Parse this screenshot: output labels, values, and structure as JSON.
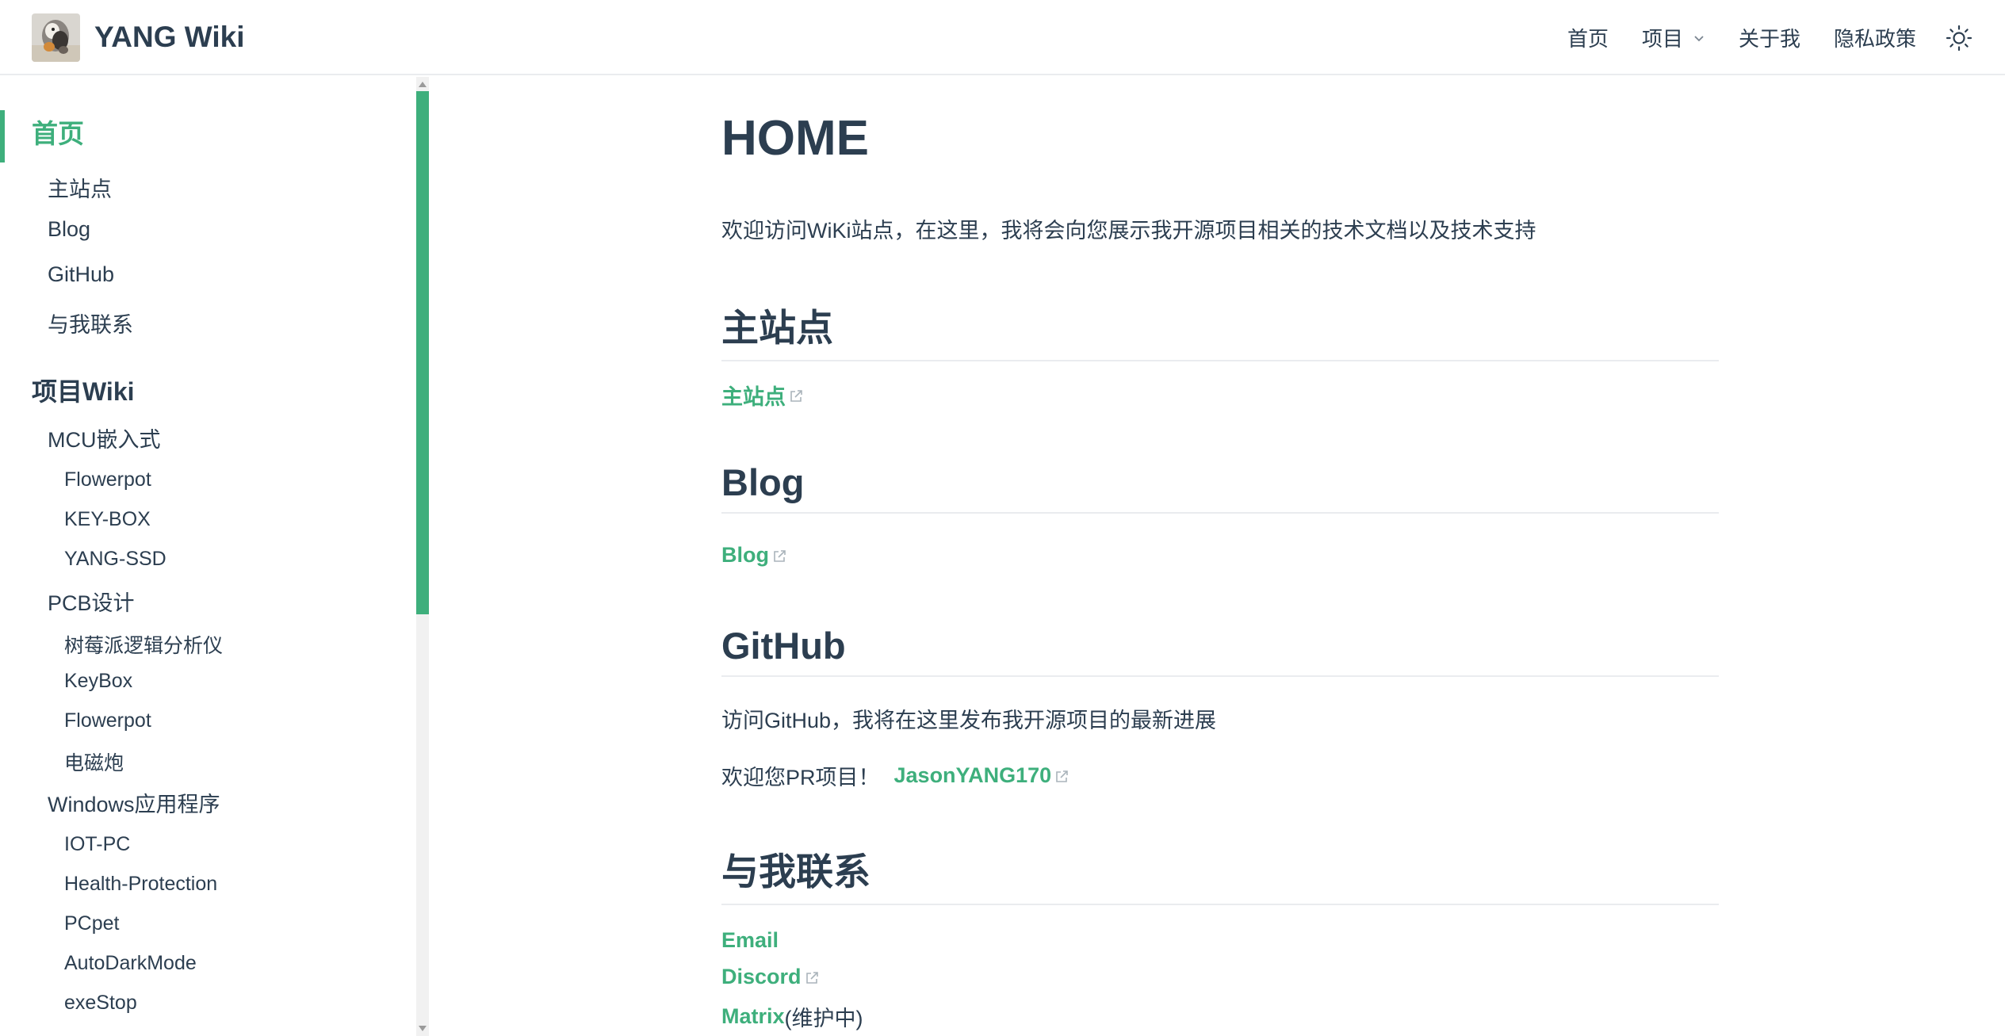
{
  "navbar": {
    "site_name": "YANG Wiki",
    "logo_icon": "avatar-logo-icon",
    "items": [
      {
        "label": "首页"
      },
      {
        "label": "项目",
        "dropdown": true
      },
      {
        "label": "关于我"
      },
      {
        "label": "隐私政策"
      }
    ],
    "theme_icon": "sun-icon"
  },
  "sidebar": {
    "active_heading": "首页",
    "home_children": [
      "主站点",
      "Blog",
      "GitHub",
      "与我联系"
    ],
    "project_heading": "项目Wiki",
    "groups": [
      {
        "label": "MCU嵌入式",
        "items": [
          "Flowerpot",
          "KEY-BOX",
          "YANG-SSD"
        ]
      },
      {
        "label": "PCB设计",
        "items": [
          "树莓派逻辑分析仪",
          "KeyBox",
          "Flowerpot",
          "电磁炮"
        ]
      },
      {
        "label": "Windows应用程序",
        "items": [
          "IOT-PC",
          "Health-Protection",
          "PCpet",
          "AutoDarkMode",
          "exeStop"
        ]
      }
    ]
  },
  "main": {
    "title": "HOME",
    "intro": "欢迎访问WiKi站点，在这里，我将会向您展示我开源项目相关的技术文档以及技术支持",
    "sections": {
      "main_site": {
        "heading": "主站点",
        "link": "主站点"
      },
      "blog": {
        "heading": "Blog",
        "link": "Blog"
      },
      "github": {
        "heading": "GitHub",
        "text": "访问GitHub，我将在这里发布我开源项目的最新进展",
        "pr_text": "欢迎您PR项目！",
        "pr_link": "JasonYANG170"
      },
      "contact": {
        "heading": "与我联系",
        "email": "Email",
        "discord": "Discord",
        "matrix": "Matrix",
        "matrix_note": "(维护中)"
      }
    }
  },
  "colors": {
    "accent": "#3eaf7c",
    "text": "#2c3e50",
    "border": "#eaecef"
  }
}
